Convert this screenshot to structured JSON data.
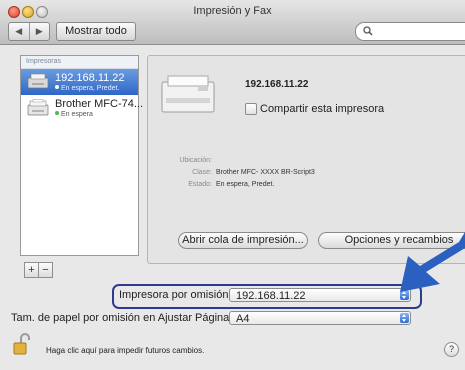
{
  "window": {
    "title": "Impresión y Fax",
    "show_all_label": "Mostrar todo",
    "back_icon": "◀",
    "forward_icon": "▶"
  },
  "printers": {
    "header": "Impresoras",
    "items": [
      {
        "name": "192.168.11.22",
        "status": "En espera, Predet.",
        "selected": true
      },
      {
        "name": "Brother MFC-74...",
        "status": "En espera",
        "selected": false
      }
    ]
  },
  "detail": {
    "printer_name": "192.168.11.22",
    "share_label": "Compartir esta impresora",
    "location_label": "Ubicación:",
    "location_value": "",
    "class_label": "Clase:",
    "class_value": "Brother MFC- XXXX BR-Script3",
    "status_label": "Estado:",
    "status_value": "En espera, Predet.",
    "open_queue_label": "Abrir cola de impresión...",
    "options_label": "Opciones y recambios"
  },
  "defaults": {
    "default_printer_label": "Impresora por omisión:",
    "default_printer_value": "192.168.11.22",
    "paper_size_label": "Tam. de papel por omisión en Ajustar Página:",
    "paper_size_value": "A4"
  },
  "footer": {
    "lock_text": "Haga clic aquí para impedir futuros cambios.",
    "help_symbol": "?"
  },
  "colors": {
    "selection": "#2f67c7",
    "highlight_box": "#2d3a8f",
    "arrow": "#2b5fc0"
  }
}
